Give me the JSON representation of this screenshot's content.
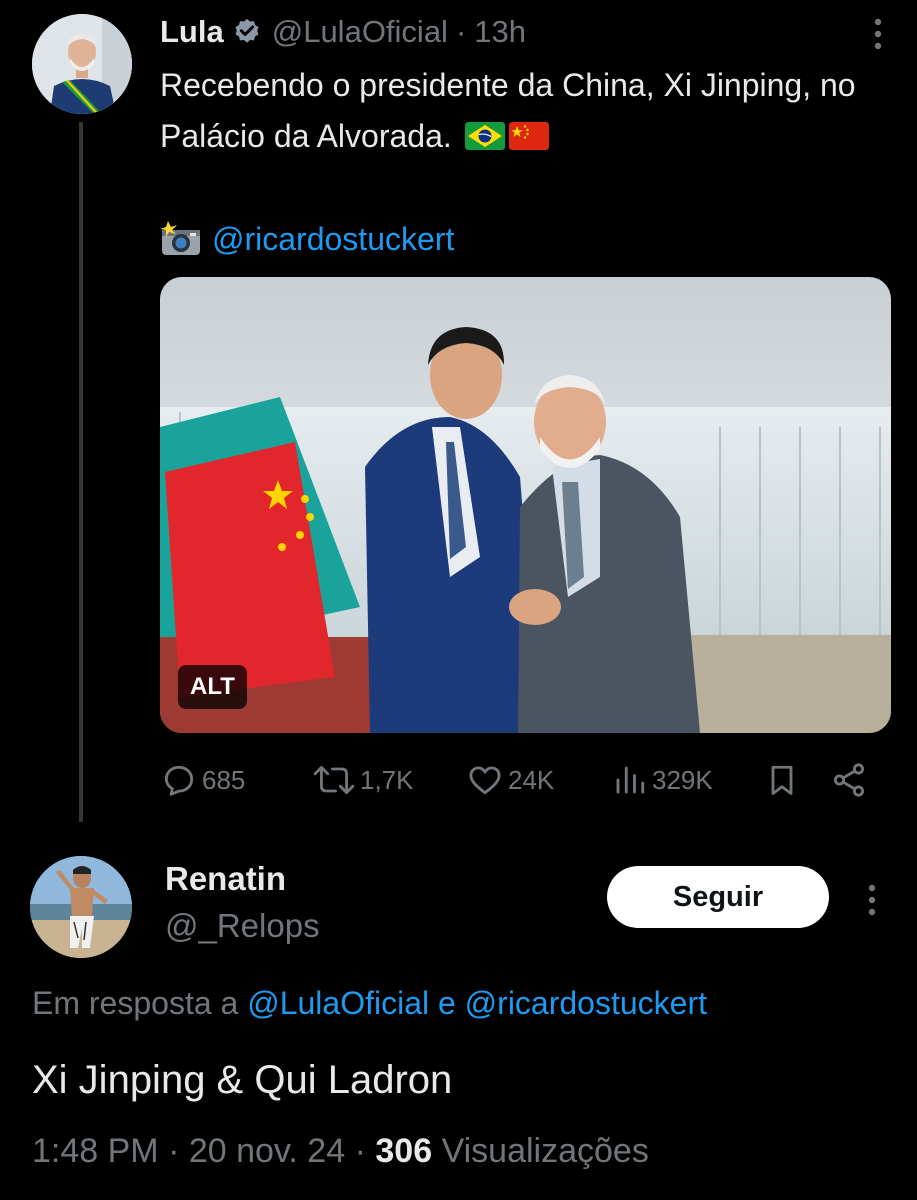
{
  "tweet": {
    "author_name": "Lula",
    "author_handle": "@LulaOficial",
    "separator": "·",
    "time": "13h",
    "text": "Recebendo o presidente da China, Xi Jinping, no Palácio da Alvorada.",
    "credit_mention": "@ricardostuckert",
    "media_alt_badge": "ALT",
    "stats": {
      "replies": "685",
      "reposts": "1,7K",
      "likes": "24K",
      "views": "329K"
    }
  },
  "reply": {
    "author_name": "Renatin",
    "author_handle": "@_Relops",
    "follow_label": "Seguir",
    "reply_prefix": "Em resposta a",
    "reply_user1": "@LulaOficial",
    "reply_conj": "e",
    "reply_user2": "@ricardostuckert",
    "text": "Xi Jinping & Qui Ladron",
    "time": "1:48 PM",
    "date": "20 nov. 24",
    "views_count": "306",
    "views_label": "Visualizações"
  },
  "icons": {
    "verified": "verified-badge-icon",
    "more": "more-vertical-icon",
    "camera": "camera-flash-icon",
    "reply": "reply-bubble-icon",
    "repost": "repost-icon",
    "like": "heart-icon",
    "views": "views-bars-icon",
    "bookmark": "bookmark-icon",
    "share": "share-icon"
  },
  "colors": {
    "background": "#000000",
    "text_primary": "#e7e9ea",
    "text_secondary": "#71767b",
    "link": "#1d9bf0"
  }
}
